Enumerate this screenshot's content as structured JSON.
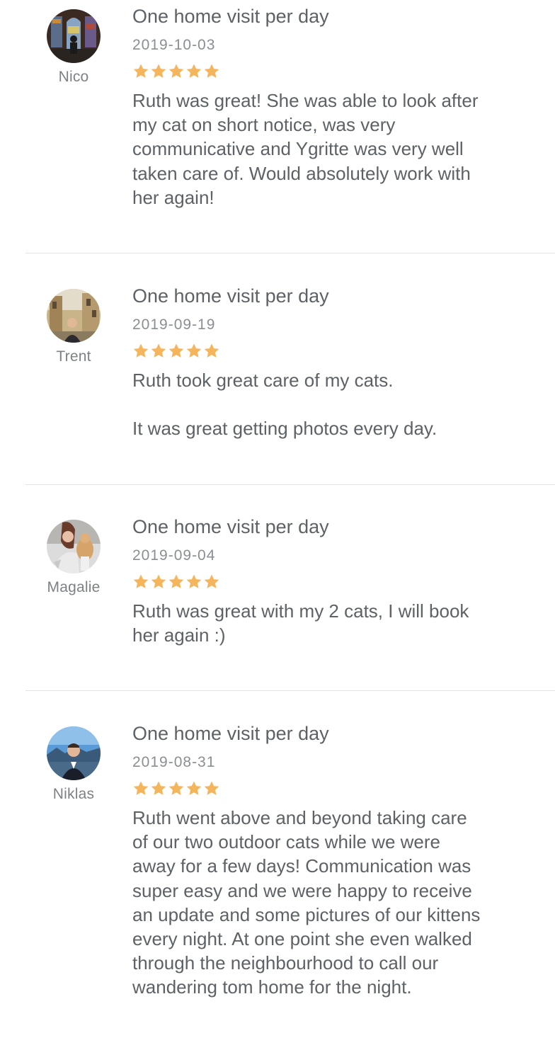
{
  "colors": {
    "star": "#f5b55c",
    "divider": "#e3e3e3"
  },
  "reviews": [
    {
      "reviewer": "Nico",
      "service": "One home visit per day",
      "date": "2019-10-03",
      "rating": 5,
      "text": "Ruth was great! She was able to look after\nmy cat on short notice, was very\ncommunicative and Ygritte was very well\ntaken care of. Would absolutely work with\nher again!"
    },
    {
      "reviewer": "Trent",
      "service": "One home visit per day",
      "date": "2019-09-19",
      "rating": 5,
      "text": "Ruth took great care of my cats.\n\nIt was great getting photos every day."
    },
    {
      "reviewer": "Magalie",
      "service": "One home visit per day",
      "date": "2019-09-04",
      "rating": 5,
      "text": "Ruth was great with my 2 cats, I will book\nher again :)"
    },
    {
      "reviewer": "Niklas",
      "service": "One home visit per day",
      "date": "2019-08-31",
      "rating": 5,
      "text": "Ruth went above and beyond taking care\nof our two outdoor cats while we were\naway for a few days! Communication was\nsuper easy and we were happy to receive\nan update and some pictures of our kittens\nevery night. At one point she even walked\nthrough the neighbourhood to call our\nwandering tom home for the night."
    }
  ]
}
